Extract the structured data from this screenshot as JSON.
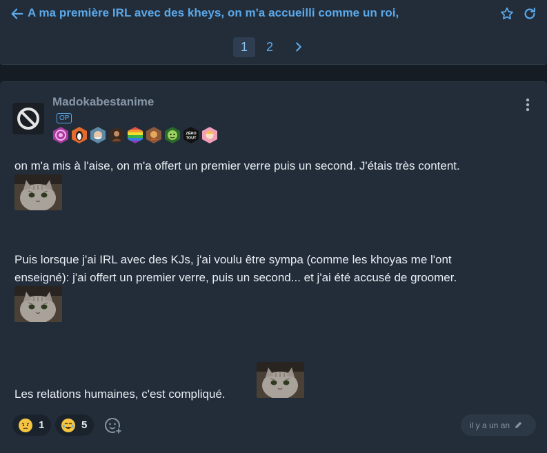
{
  "header": {
    "title": "A ma première IRL avec des kheys, on m'a accueilli comme un roi,"
  },
  "pagination": {
    "pages": [
      "1",
      "2"
    ],
    "current": "1"
  },
  "post": {
    "author": "Madokabestanime",
    "op_label": "OP",
    "badges": [
      {
        "name": "badge-swirl",
        "color": "#d44cc4"
      },
      {
        "name": "badge-penguin",
        "color": "#e36a2a"
      },
      {
        "name": "badge-old-man",
        "color": "#8ab0c8"
      },
      {
        "name": "badge-portrait",
        "color": "#7a4a2e"
      },
      {
        "name": "badge-rainbow",
        "color": "#e34a4a"
      },
      {
        "name": "badge-character",
        "color": "#c4612a"
      },
      {
        "name": "badge-green-face",
        "color": "#3a9a3a"
      },
      {
        "name": "badge-zero-tout",
        "color": "#111111",
        "text": "ZÉRO TOUT"
      },
      {
        "name": "badge-girl",
        "color": "#e05a78"
      }
    ],
    "paragraphs": {
      "p1": "on m'a mis à l'aise, on m'a offert un premier verre puis un second. J'étais très content.",
      "p2_line1": "Puis lorsque j'ai IRL avec des KJs, j'ai voulu être sympa (comme les khoyas me l'ont",
      "p2_line2": "enseigné): j'ai offert un premier verre, puis un second... et j'ai été accusé de groomer.",
      "p3": "Les relations humaines, c'est compliqué."
    },
    "reactions": [
      {
        "emoji": "worried-face",
        "count": "1"
      },
      {
        "emoji": "laughing-face",
        "count": "5"
      }
    ],
    "timestamp": "il y a un an"
  },
  "colors": {
    "accent": "#5aa9ea",
    "background": "#151c24",
    "card": "#232d3a"
  }
}
